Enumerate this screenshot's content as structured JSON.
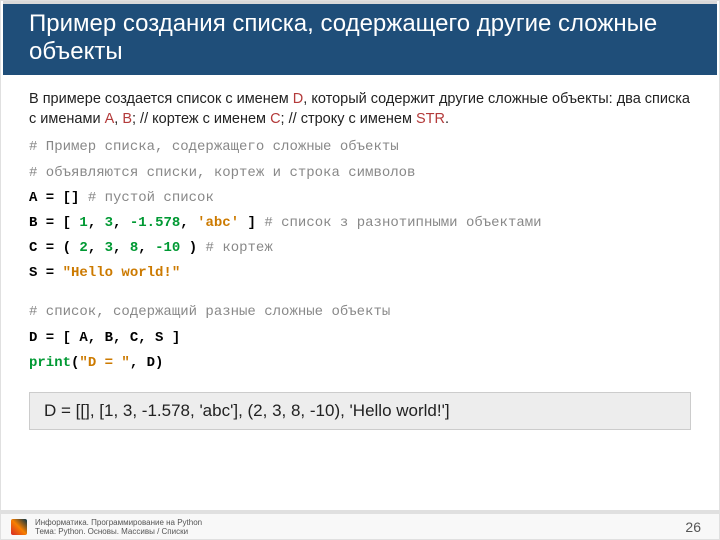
{
  "title": "Пример создания списка, содержащего другие сложные объекты",
  "intro": {
    "t1": "В примере создается список с именем ",
    "v1": "D",
    "t2": ", который содержит другие сложные объекты: два списка с именами ",
    "v2": "A",
    "t3": ", ",
    "v3": "B",
    "t4": "; // кортеж с именем ",
    "v4": "C",
    "t5": "; // строку с именем ",
    "v5": "STR",
    "t6": "."
  },
  "code": {
    "l1": "# Пример списка, содержащего сложные объекты",
    "l2": "# объявляются списки, кортеж и строка символов",
    "l3a": "A = []",
    "l3b": " # пустой список",
    "l4a": "B = [ ",
    "l4n1": "1",
    "l4c1": ", ",
    "l4n2": "3",
    "l4c2": ", ",
    "l4n3": "-1.578",
    "l4c3": ", ",
    "l4s": "'abc'",
    "l4c4": " ]",
    "l4cm": " # список з разнотипными объектами",
    "l5a": "C = ( ",
    "l5n1": "2",
    "l5c1": ", ",
    "l5n2": "3",
    "l5c2": ", ",
    "l5n3": "8",
    "l5c3": ", ",
    "l5n4": "-10",
    "l5c4": " )",
    "l5cm": " # кортеж",
    "l6a": "S = ",
    "l6s": "\"Hello world!\"",
    "l7": "# список, содержащий разные сложные объекты",
    "l8": "D = [ A, B, C, S ]",
    "l9f": "print",
    "l9a": "(",
    "l9s": "\"D = \"",
    "l9b": ", D)"
  },
  "output": "D =  [[], [1, 3, -1.578, 'abc'], (2, 3, 8, -10), 'Hello world!']",
  "footer": {
    "line1": "Информатика. Программирование на Python",
    "line2": "Тема: Python. Основы. Массивы / Списки",
    "page": "26"
  }
}
